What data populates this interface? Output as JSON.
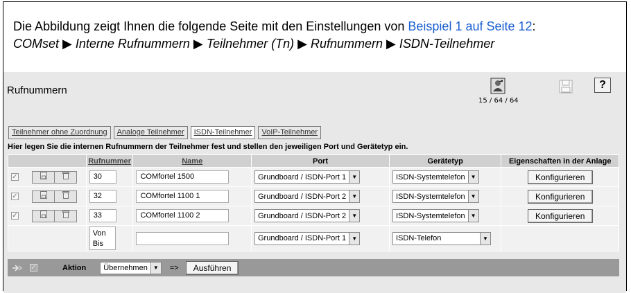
{
  "caption": {
    "intro": "Die Abbildung zeigt Ihnen die folgende Seite mit den Einstellungen von ",
    "link": "Beispiel 1 auf Seite 12",
    "colon": ":",
    "path": "COMset ▶ Interne Rufnummern ▶ Teilnehmer (Tn) ▶ Rufnummern ▶ ISDN-Teilnehmer"
  },
  "page": {
    "title": "Rufnummern",
    "count": "15 / 64 / 64"
  },
  "tabs": [
    {
      "label": "Teilnehmer ohne Zuordnung",
      "active": false
    },
    {
      "label": "Analoge Teilnehmer",
      "active": false
    },
    {
      "label": "ISDN-Teilnehmer",
      "active": true
    },
    {
      "label": "VoIP-Teilnehmer",
      "active": false
    }
  ],
  "instruction": "Hier legen Sie die internen Rufnummern der Teilnehmer fest und stellen den jeweiligen Port und Gerätetyp ein.",
  "table": {
    "headers": {
      "rufnummer": "Rufnummer",
      "name": "Name",
      "port": "Port",
      "geraetetyp": "Gerätetyp",
      "eigenschaften": "Eigenschaften in der Anlage"
    },
    "rows": [
      {
        "rufnummer": "30",
        "name": "COMfortel 1500",
        "port": "Grundboard / ISDN-Port 1",
        "geraetetyp": "ISDN-Systemtelefon",
        "action": "Konfigurieren"
      },
      {
        "rufnummer": "32",
        "name": "COMfortel 1100 1",
        "port": "Grundboard / ISDN-Port 2",
        "geraetetyp": "ISDN-Systemtelefon",
        "action": "Konfigurieren"
      },
      {
        "rufnummer": "33",
        "name": "COMfortel 1100 2",
        "port": "Grundboard / ISDN-Port 2",
        "geraetetyp": "ISDN-Systemtelefon",
        "action": "Konfigurieren"
      }
    ],
    "new_row": {
      "von": "Von",
      "bis": "Bis",
      "name": "",
      "port": "Grundboard / ISDN-Port 1",
      "geraetetyp": "ISDN-Telefon"
    }
  },
  "action_bar": {
    "label": "Aktion",
    "select": "Übernehmen",
    "arrow": "=>",
    "execute": "Ausführen"
  }
}
